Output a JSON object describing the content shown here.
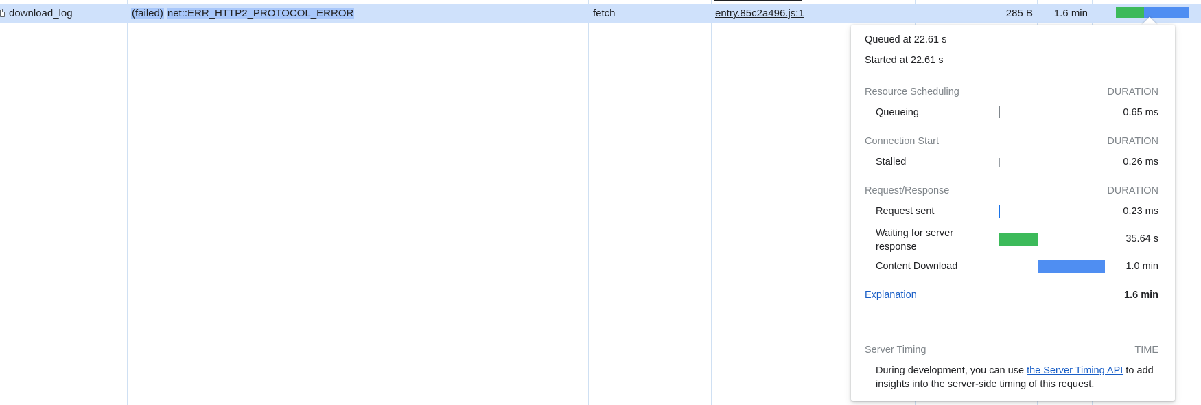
{
  "row": {
    "name": "download_log",
    "status_prefix": "(failed)",
    "status_error": "net::ERR_HTTP2_PROTOCOL_ERROR",
    "type": "fetch",
    "initiator": "entry.85c2a496.js:1",
    "size": "285 B",
    "time": "1.6 min"
  },
  "timing": {
    "queued_at": "Queued at 22.61 s",
    "started_at": "Started at 22.61 s",
    "duration_label": "DURATION",
    "sections": [
      {
        "title": "Resource Scheduling",
        "phases": [
          {
            "label": "Queueing",
            "value": "0.65 ms",
            "color": "#80868b"
          }
        ]
      },
      {
        "title": "Connection Start",
        "phases": [
          {
            "label": "Stalled",
            "value": "0.26 ms",
            "color": "#9aa0a6"
          }
        ]
      },
      {
        "title": "Request/Response",
        "phases": [
          {
            "label": "Request sent",
            "value": "0.23 ms",
            "color": "#1a73e8"
          },
          {
            "label": "Waiting for server response",
            "value": "35.64 s",
            "color": "#3cba5a"
          },
          {
            "label": "Content Download",
            "value": "1.0 min",
            "color": "#4f8ef2"
          }
        ]
      }
    ],
    "explanation_link": "Explanation",
    "total": "1.6 min",
    "server_timing": {
      "title": "Server Timing",
      "time_label": "TIME",
      "text_before": "During development, you can use",
      "link": "the Server Timing API",
      "text_after": "to add insights into the server-side timing of this request."
    }
  }
}
